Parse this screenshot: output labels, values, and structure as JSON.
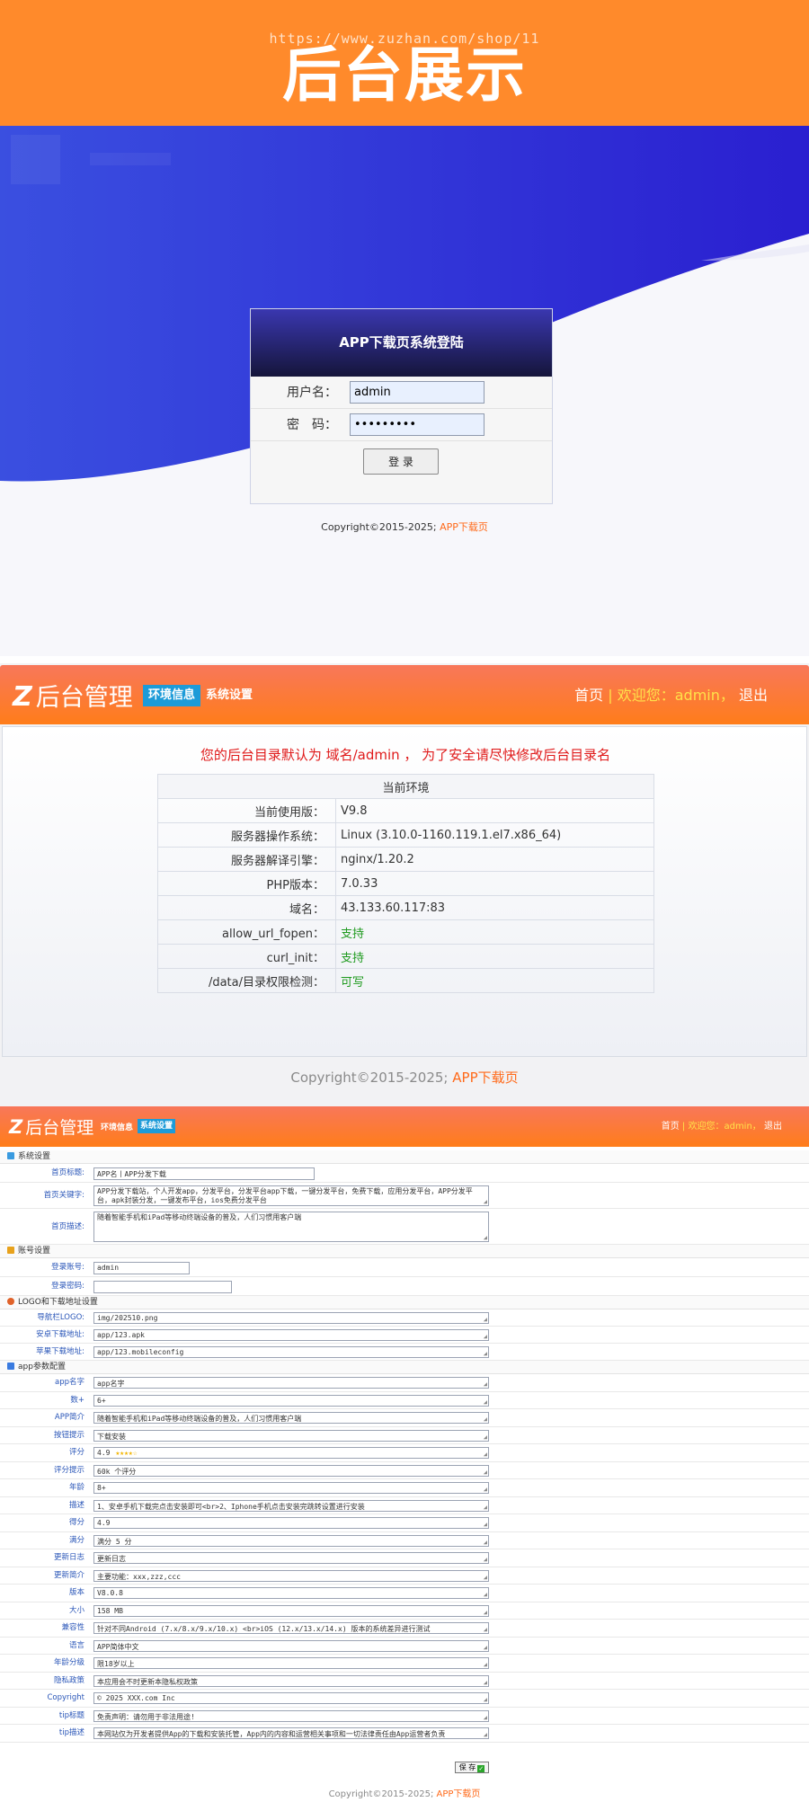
{
  "banner": {
    "title": "后台展示",
    "watermark": "https://www.zuzhan.com/shop/11"
  },
  "login": {
    "title": "APP下载页系统登陆",
    "username_label": "用户名：",
    "username_value": "admin",
    "password_label": "密　码：",
    "password_value": "•••••••••",
    "login_button": "登 录",
    "copyright": "Copyright©2015-2025;",
    "copyright_link": "APP下载页"
  },
  "admin_header": {
    "logo_text": "后台管理",
    "tabs": [
      "环境信息",
      "系统设置"
    ],
    "home": "首页",
    "sep": "|",
    "welcome": "欢迎您：admin，",
    "logout": "退出"
  },
  "env": {
    "warning": "您的后台目录默认为 域名/admin ， 为了安全请尽快修改后台目录名",
    "table_title": "当前环境",
    "rows": [
      {
        "k": "当前使用版：",
        "v": "V9.8"
      },
      {
        "k": "服务器操作系统：",
        "v": "Linux (3.10.0-1160.119.1.el7.x86_64)"
      },
      {
        "k": "服务器解译引擎：",
        "v": "nginx/1.20.2"
      },
      {
        "k": "PHP版本：",
        "v": "7.0.33"
      },
      {
        "k": "域名：",
        "v": "43.133.60.117:83"
      },
      {
        "k": "allow_url_fopen：",
        "v": "支持"
      },
      {
        "k": "curl_init：",
        "v": "支持"
      },
      {
        "k": "/data/目录权限检测：",
        "v": "可写"
      }
    ],
    "copyright": "Copyright©2015-2025;",
    "copyright_link": "APP下载页"
  },
  "settings": {
    "sections": {
      "system": "系统设置",
      "account": "账号设置",
      "logo": "LOGO和下载地址设置",
      "app": "app参数配置"
    },
    "system_rows": [
      {
        "k": "首页标题:",
        "v": "APP名丨APP分发下载"
      },
      {
        "k": "首页关键字:",
        "v": "APP分发下载站，个人开发app，分发平台，分发平台app下载，一键分发平台，免费下载，应用分发平台，APP分发平台，apk封装分发，一键发布平台，ios免费分发平台"
      },
      {
        "k": "首页描述:",
        "v": "随着智能手机和iPad等移动终端设备的普及，人们习惯用客户端"
      }
    ],
    "account_rows": [
      {
        "k": "登录账号:",
        "v": "admin"
      },
      {
        "k": "登录密码:",
        "v": ""
      }
    ],
    "logo_rows": [
      {
        "k": "导航栏LOGO:",
        "v": "img/202510.png"
      },
      {
        "k": "安卓下载地址:",
        "v": "app/123.apk"
      },
      {
        "k": "苹果下载地址:",
        "v": "app/123.mobileconfig"
      }
    ],
    "app_rows": [
      {
        "k": "app名字",
        "v": "app名字"
      },
      {
        "k": "数+",
        "v": "6+"
      },
      {
        "k": "APP简介",
        "v": "随着智能手机和iPad等移动终端设备的普及，人们习惯用客户端"
      },
      {
        "k": "按钮提示",
        "v": "下载安装"
      },
      {
        "k": "评分",
        "v": "4.9"
      },
      {
        "k": "评分提示",
        "v": "60k 个评分"
      },
      {
        "k": "年龄",
        "v": "8+"
      },
      {
        "k": "描述",
        "v": "1、安卓手机下载完点击安装即可<br>2、Iphone手机点击安装完跳转设置进行安装"
      },
      {
        "k": "得分",
        "v": "4.9"
      },
      {
        "k": "满分",
        "v": "满分 5 分"
      },
      {
        "k": "更新日志",
        "v": "更新日志"
      },
      {
        "k": "更新简介",
        "v": "主要功能：xxx,zzz,ccc"
      },
      {
        "k": "版本",
        "v": "V8.0.8"
      },
      {
        "k": "大小",
        "v": "158 MB"
      },
      {
        "k": "兼容性",
        "v": "针对不同Android (7.x/8.x/9.x/10.x) <br>iOS (12.x/13.x/14.x) 版本的系统差异进行测试"
      },
      {
        "k": "语言",
        "v": "APP简体中文"
      },
      {
        "k": "年龄分级",
        "v": "限18岁以上"
      },
      {
        "k": "隐私政策",
        "v": "本应用会不时更新本隐私权政策"
      },
      {
        "k": "Copyright",
        "v": "© 2025 XXX.com Inc"
      },
      {
        "k": "tip标题",
        "v": "免责声明：请勿用于非法用途!"
      },
      {
        "k": "tip描述",
        "v": "本网站仅为开发者提供App的下载和安装托管，App内的内容和运营相关事项和一切法律责任由App运营者负责"
      }
    ],
    "rating_stars": "★★★★☆",
    "save_button": "保 存",
    "save_check": "✓",
    "copyright": "Copyright©2015-2025;",
    "copyright_link": "APP下载页"
  }
}
